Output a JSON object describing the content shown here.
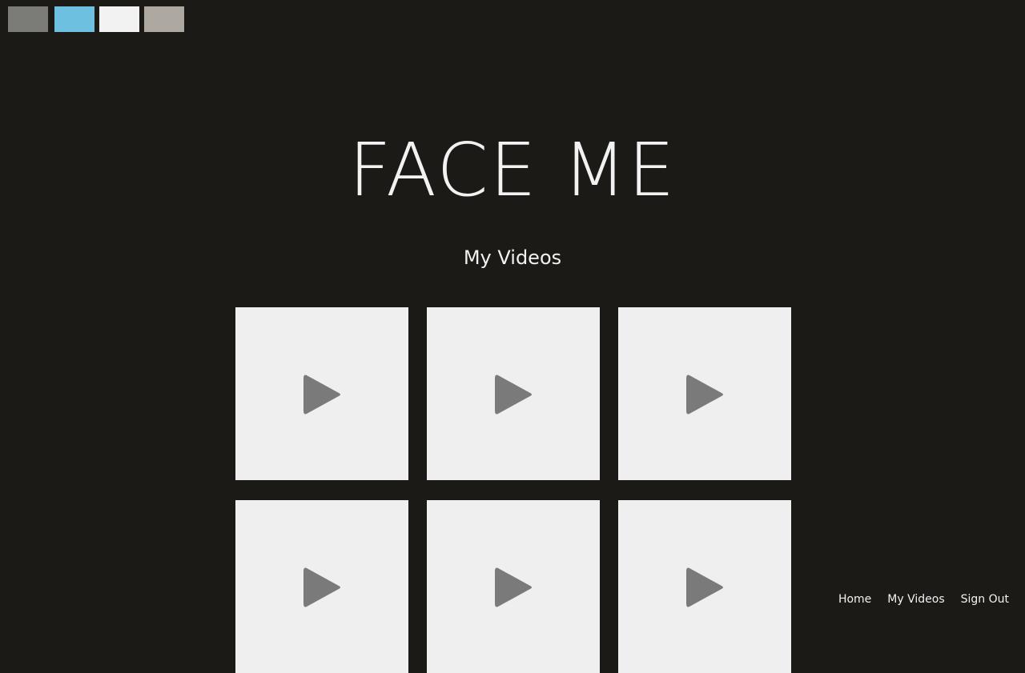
{
  "swatches": [
    {
      "name": "gray",
      "color": "#7b7c78"
    },
    {
      "name": "sky",
      "color": "#6ec0e1"
    },
    {
      "name": "white",
      "color": "#f2f2f2"
    },
    {
      "name": "taupe",
      "color": "#aea9a0"
    }
  ],
  "app": {
    "title": "FACE ME"
  },
  "page": {
    "section_title": "My Videos"
  },
  "videos": [
    {
      "icon": "play-icon"
    },
    {
      "icon": "play-icon"
    },
    {
      "icon": "play-icon"
    },
    {
      "icon": "play-icon"
    },
    {
      "icon": "play-icon"
    },
    {
      "icon": "play-icon"
    }
  ],
  "nav": {
    "home": "Home",
    "my_videos": "My Videos",
    "sign_out": "Sign Out"
  },
  "colors": {
    "background": "#1b1a16",
    "tile": "#efefef",
    "play_icon": "#7a7a7a",
    "text": "#f2f2f2"
  }
}
